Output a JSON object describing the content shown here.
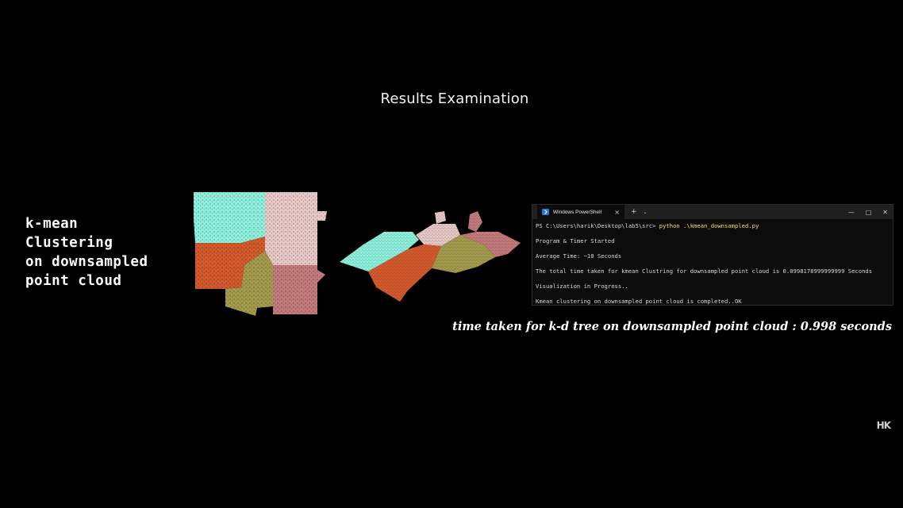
{
  "title": "Results Examination",
  "left_label": {
    "lines": [
      "k-mean",
      "Clustering",
      "on downsampled",
      "point cloud"
    ]
  },
  "terminal": {
    "tab_title": "Windows PowerShell",
    "tab_close": "×",
    "new_tab": "+",
    "dropdown": "⌄",
    "minimize": "—",
    "maximize": "□",
    "close": "✕",
    "prompt": "PS C:\\Users\\harik\\Desktop\\lab5\\src> ",
    "command": "python .\\kmean_downsampled.py",
    "output": [
      "Program & Timer Started",
      "Average Time: ~10 Seconds",
      "The total time taken for kmean Clustring for downsampled point cloud is 0.0998178999999999 Seconds",
      "Visualization in Progress..",
      "Kmean clustering on downsampled point cloud is completed..OK"
    ]
  },
  "caption": "time taken for k-d tree on downsampled point cloud : 0.998 seconds",
  "logo": "HK",
  "colors": {
    "cyan": "#8ef0dc",
    "pink": "#e4c4c4",
    "orange": "#d85a2c",
    "olive": "#a99a4a",
    "mauve": "#c47878",
    "ps_blue": "#2b78d0",
    "cmd_yellow": "#f2e35a"
  }
}
